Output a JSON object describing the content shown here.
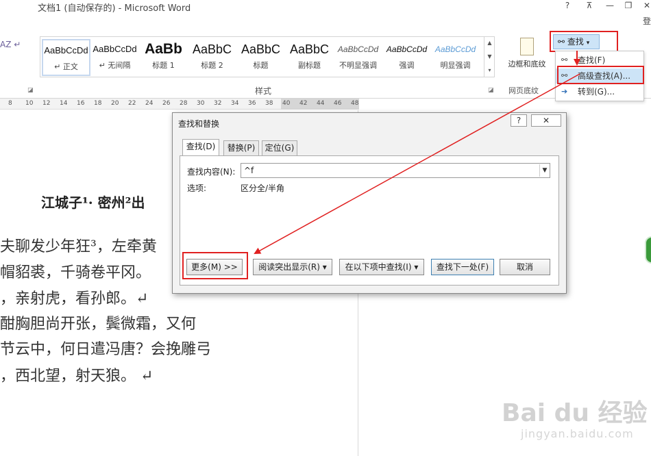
{
  "window": {
    "title": "文档1 (自动保存的) - Microsoft Word",
    "help": "?",
    "restore_ribbon": "⊼",
    "minimize": "—",
    "maximize": "❐",
    "close": "✕",
    "login": "登"
  },
  "ribbon": {
    "left_fragments": "AZ  ↵",
    "styles": [
      {
        "sample": "AaBbCcDd",
        "label": "↵ 正文",
        "selected": true
      },
      {
        "sample": "AaBbCcDd",
        "label": "↵ 无间隔"
      },
      {
        "sample": "AaBb",
        "label": "标题 1"
      },
      {
        "sample": "AaBbC",
        "label": "标题 2"
      },
      {
        "sample": "AaBbC",
        "label": "标题"
      },
      {
        "sample": "AaBbC",
        "label": "副标题"
      },
      {
        "sample": "AaBbCcDd",
        "label": "不明显强调"
      },
      {
        "sample": "AaBbCcDd",
        "label": "强调"
      },
      {
        "sample": "AaBbCcDd",
        "label": "明显强调"
      }
    ],
    "styles_group_label": "样式",
    "border_shading_label": "边框和底纹",
    "web_background_label": "网页底纹",
    "find_button_label": "查找",
    "find_menu": [
      {
        "label": "查找(F)",
        "icon": "binoculars-icon"
      },
      {
        "label": "高级查找(A)...",
        "icon": "binoculars-icon",
        "highlighted": true
      },
      {
        "label": "转到(G)...",
        "icon": "arrow-right-icon"
      }
    ]
  },
  "ruler": {
    "ticks": [
      "8",
      "10",
      "12",
      "14",
      "16",
      "18",
      "20",
      "22",
      "24",
      "26",
      "28",
      "30",
      "32",
      "34",
      "36",
      "38",
      "40",
      "42",
      "44",
      "46",
      "48"
    ]
  },
  "document": {
    "title": "江城子¹· 密州²出",
    "lines": [
      "夫聊发少年狂³，左牵黄",
      "帽貂裘，千骑卷平冈。",
      "，亲射虎，看孙郎。↵",
      "酣胸胆尚开张，鬓微霜，又何",
      "节云中，何日遣冯唐？会挽雕弓",
      "，西北望，射天狼。   ↵"
    ]
  },
  "dialog": {
    "title": "查找和替换",
    "help": "?",
    "close": "✕",
    "tabs": [
      "查找(D)",
      "替换(P)",
      "定位(G)"
    ],
    "find_label": "查找内容(N):",
    "find_value": "^f",
    "options_label": "选项:",
    "options_value": "区分全/半角",
    "buttons": {
      "more": "更多(M) >>",
      "reading_highlight": "阅读突出显示(R) ▾",
      "find_in": "在以下项中查找(I) ▾",
      "find_next": "查找下一处(F)",
      "cancel": "取消"
    }
  },
  "watermark": {
    "logo": "Bai du 经验",
    "url": "jingyan.baidu.com"
  },
  "colors": {
    "annotation_red": "#e02020",
    "highlight_blue": "#cde4f7"
  }
}
